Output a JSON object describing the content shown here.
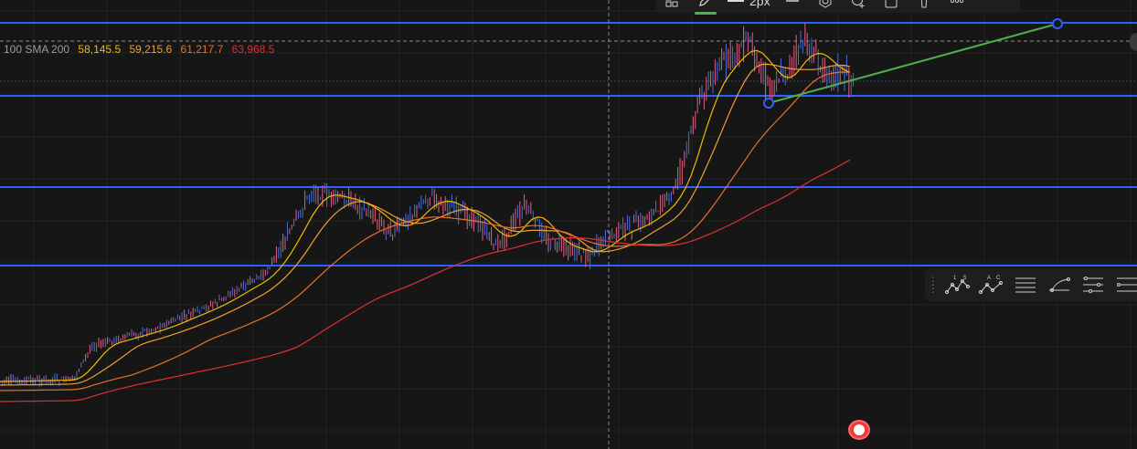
{
  "legend": {
    "label": "100 SMA 200",
    "values": [
      {
        "text": "58,145.5",
        "color": "#f5b800"
      },
      {
        "text": "59,215.6",
        "color": "#f0a030"
      },
      {
        "text": "61,217.7",
        "color": "#e8702a"
      },
      {
        "text": "63,968.5",
        "color": "#e03030"
      }
    ]
  },
  "top_toolbar": {
    "line_width_label": "2px",
    "buttons": [
      {
        "name": "add-to-favorites-icon"
      },
      {
        "name": "pencil-color-icon"
      },
      {
        "name": "line-width-button"
      },
      {
        "name": "line-style-icon"
      },
      {
        "name": "settings-icon"
      },
      {
        "name": "add-alert-icon"
      },
      {
        "name": "lock-icon"
      },
      {
        "name": "delete-icon"
      },
      {
        "name": "more-icon"
      }
    ]
  },
  "fib_toolbar": {
    "buttons": [
      {
        "name": "elliott-wave-1-5-icon",
        "label_a": "1",
        "label_b": "5"
      },
      {
        "name": "abc-wave-icon",
        "label_a": "A",
        "label_b": "C"
      },
      {
        "name": "horizontal-lines-icon"
      },
      {
        "name": "fib-fan-icon"
      },
      {
        "name": "fib-levels-icon"
      },
      {
        "name": "fib-extension-icon"
      }
    ]
  },
  "colors": {
    "background": "#161616",
    "grid": "#232323",
    "hline": "#2962ff",
    "trend": "#4caf50",
    "candle_up": "#e06080",
    "candle_down": "#4a6fdc",
    "sma_fast": "#f5b800",
    "sma_mid": "#f0a030",
    "sma_slow": "#e8702a",
    "sma_200": "#e03030"
  }
}
